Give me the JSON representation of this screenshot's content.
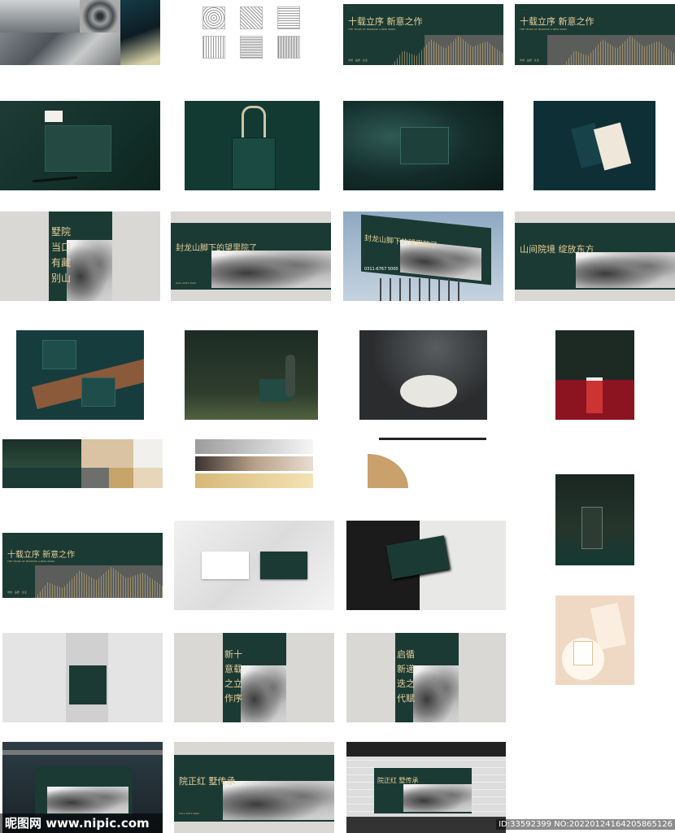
{
  "tiles": {
    "row1_banner_a": {
      "headline": "十载立序 新意之作",
      "subline": "THE YEARS OF PROPOSE A NEW WORK",
      "footer": "市场 · 品质 · 生活"
    },
    "row1_banner_b": {
      "headline": "十载立序 新意之作",
      "subline": "THE YEARS OF PROPOSE A NEW WORK",
      "footer": "市场 · 品质 · 生活"
    },
    "row3_poster": {
      "line1": "墅院",
      "line2": "当口",
      "line3": "有藏",
      "line4": "别山"
    },
    "row3_banner_a": {
      "headline": "封龙山脚下的望里院了",
      "phone": "0311-6767 5000"
    },
    "row3_billboard": {
      "headline": "封龙山脚下的望里院了",
      "phone": "0311-6767 5000"
    },
    "row3_banner_b": {
      "headline": "山间院境 绽放东方"
    },
    "row6_banner": {
      "headline": "十载立序 新意之作",
      "subline": "THE YEARS OF PROPOSE A NEW WORK",
      "footer": "市场 · 品质 · 生活"
    },
    "row7_poster_a": {
      "line1": "新十",
      "line2": "意载",
      "line3": "之立",
      "line4": "作序"
    },
    "row7_poster_b": {
      "line1": "启循",
      "line2": "新递",
      "line3": "迭之",
      "line4": "代赋"
    },
    "row8_banner": {
      "headline": "院正红 墅传承",
      "phone": "0311-6767 5000"
    },
    "row8_subway": {
      "headline": "院正红 墅传承"
    }
  },
  "watermark": {
    "logo": "昵图网 www.nipic.com",
    "id": "ID:33592399 NO:20220124164205865126"
  }
}
